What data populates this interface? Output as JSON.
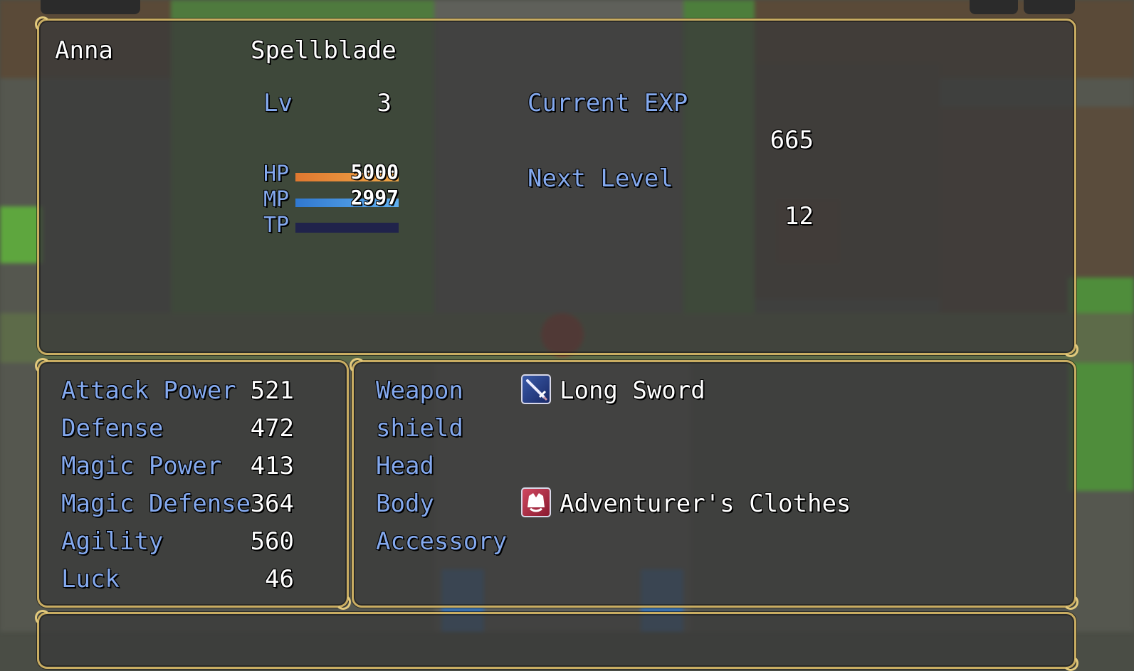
{
  "actor": {
    "name": "Anna",
    "class": "Spellblade"
  },
  "level": {
    "label": "Lv",
    "value": "3"
  },
  "exp": {
    "current_label": "Current EXP",
    "current_value": "665",
    "next_label": "Next Level",
    "next_value": "12"
  },
  "gauges": {
    "hp": {
      "label": "HP",
      "value": "5000",
      "fill_fraction": 1.0,
      "color_a": "#e07830",
      "color_b": "#f0a848"
    },
    "mp": {
      "label": "MP",
      "value": "2997",
      "fill_fraction": 1.0,
      "color_a": "#3078d0",
      "color_b": "#60b0f0"
    },
    "tp": {
      "label": "TP",
      "fill_fraction": 0.0
    }
  },
  "params": [
    {
      "label": "Attack Power",
      "value": "521"
    },
    {
      "label": "Defense",
      "value": "472"
    },
    {
      "label": "Magic Power",
      "value": "413"
    },
    {
      "label": "Magic Defense",
      "value": "364"
    },
    {
      "label": "Agility",
      "value": "560"
    },
    {
      "label": "Luck",
      "value": "46"
    }
  ],
  "equips": [
    {
      "slot": "Weapon",
      "item": "Long Sword",
      "icon": "sword-icon"
    },
    {
      "slot": "shield",
      "item": "",
      "icon": ""
    },
    {
      "slot": "Head",
      "item": "",
      "icon": ""
    },
    {
      "slot": "Body",
      "item": "Adventurer's Clothes",
      "icon": "clothes-icon"
    },
    {
      "slot": "Accessory",
      "item": "",
      "icon": ""
    }
  ],
  "colors": {
    "system_text": "#84a9ee",
    "window_border": "#c9ad62",
    "gauge_back": "#20234b"
  }
}
